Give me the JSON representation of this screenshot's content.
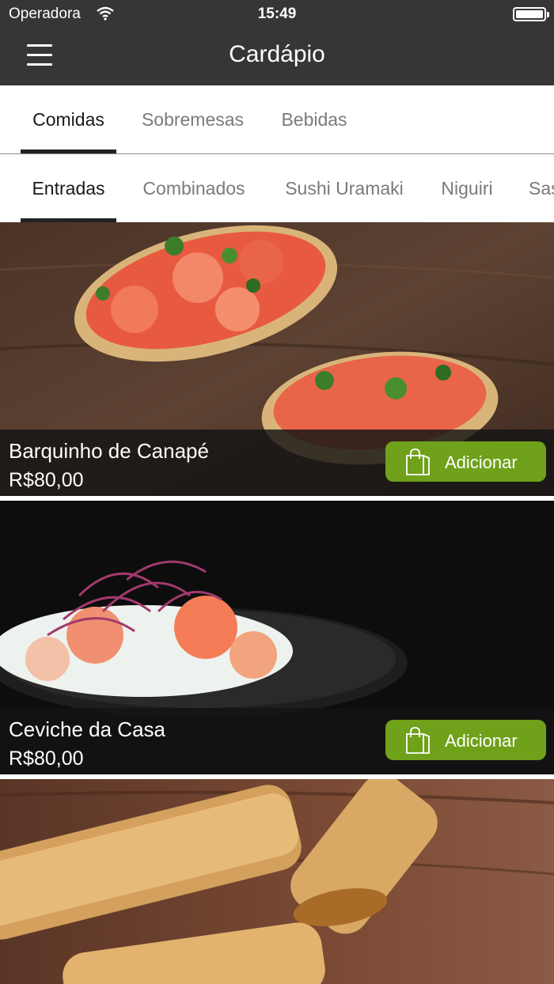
{
  "status_bar": {
    "carrier": "Operadora",
    "time": "15:49"
  },
  "header": {
    "title": "Cardápio"
  },
  "primary_tabs": [
    {
      "label": "Comidas",
      "active": true
    },
    {
      "label": "Sobremesas",
      "active": false
    },
    {
      "label": "Bebidas",
      "active": false
    }
  ],
  "secondary_tabs": [
    {
      "label": "Entradas",
      "active": true
    },
    {
      "label": "Combinados",
      "active": false
    },
    {
      "label": "Sushi Uramaki",
      "active": false
    },
    {
      "label": "Niguiri",
      "active": false
    },
    {
      "label": "Sas",
      "active": false
    }
  ],
  "menu_items": [
    {
      "name": "Barquinho de Canapé",
      "price": "R$80,00",
      "button": "Adicionar"
    },
    {
      "name": "Ceviche da Casa",
      "price": "R$80,00",
      "button": "Adicionar"
    },
    {
      "name": "",
      "price": "",
      "button": ""
    }
  ],
  "colors": {
    "header_bg": "#363636",
    "accent_green": "#6fa11a",
    "info_bar": "#1a1a1a"
  }
}
